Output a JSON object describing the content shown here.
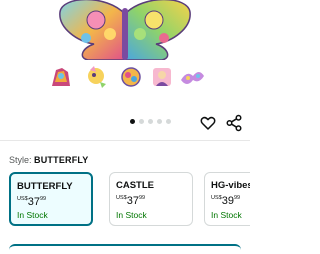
{
  "style_selector": {
    "label": "Style:",
    "selected_value": "BUTTERFLY",
    "options": [
      {
        "name": "BUTTERFLY",
        "currency": "US$",
        "dollars": "37",
        "cents": "99",
        "stock": "In Stock",
        "selected": true
      },
      {
        "name": "CASTLE",
        "currency": "US$",
        "dollars": "37",
        "cents": "99",
        "stock": "In Stock",
        "selected": false
      },
      {
        "name": "HG-vibes",
        "currency": "US$",
        "dollars": "39",
        "cents": "99",
        "stock": "In Stock",
        "selected": false
      }
    ]
  },
  "carousel": {
    "dot_count": 5,
    "active_index": 0
  },
  "thumbnail_count": 5,
  "icons": [
    "heart-icon",
    "share-icon"
  ],
  "colors": {
    "selected_border": "#007185",
    "selected_bg": "#edfdff",
    "in_stock": "#007600"
  }
}
